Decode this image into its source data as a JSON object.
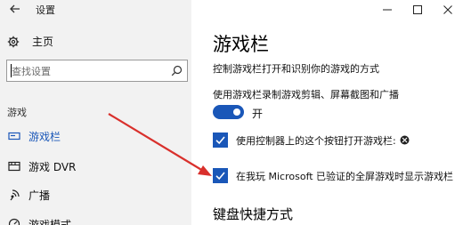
{
  "window": {
    "title": "设置"
  },
  "sidebar": {
    "home_label": "主页",
    "search_placeholder": "查找设置",
    "section_label": "游戏",
    "items": [
      {
        "label": "游戏栏",
        "icon": "game-bar-icon",
        "active": true
      },
      {
        "label": "游戏 DVR",
        "icon": "dvr-icon",
        "active": false
      },
      {
        "label": "广播",
        "icon": "broadcast-icon",
        "active": false
      },
      {
        "label": "游戏模式",
        "icon": "game-mode-icon",
        "active": false
      }
    ]
  },
  "main": {
    "title": "游戏栏",
    "description": "控制游戏栏打开和识别你的游戏的方式",
    "record_toggle": {
      "label": "使用游戏栏录制游戏剪辑、屏幕截图和广播",
      "state_text": "开",
      "on": true
    },
    "checkboxes": [
      {
        "label": "使用控制器上的这个按钮打开游戏栏:",
        "checked": true,
        "icon": "xbox-icon"
      },
      {
        "label": "在我玩 Microsoft 已验证的全屏游戏时显示游戏栏",
        "checked": true
      }
    ],
    "keyboard_section_title": "键盘快捷方式"
  },
  "colors": {
    "accent": "#1a57b8",
    "sidebar_bg": "#f2f2f2",
    "annotation_arrow": "#d9302c"
  }
}
